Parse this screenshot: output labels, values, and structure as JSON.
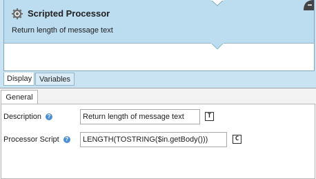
{
  "card": {
    "title": "Scripted Processor",
    "description": "Return length of message text",
    "icon": "gear-icon",
    "collapse_icon": "minus-icon"
  },
  "view_tabs": [
    {
      "label": "Display",
      "active": true
    },
    {
      "label": "Variables",
      "active": false
    }
  ],
  "properties": {
    "tab_label": "General",
    "fields": [
      {
        "label": "Description",
        "value": "Return length of message text",
        "button": "T"
      },
      {
        "label": "Processor Script",
        "value": "LENGTH(TOSTRING($in.getBody()))",
        "button": "C"
      }
    ]
  },
  "colors": {
    "frame_bg": "#c9e3f2",
    "card_header": "#bcdcf0",
    "help_icon": "#4a8fd1"
  }
}
